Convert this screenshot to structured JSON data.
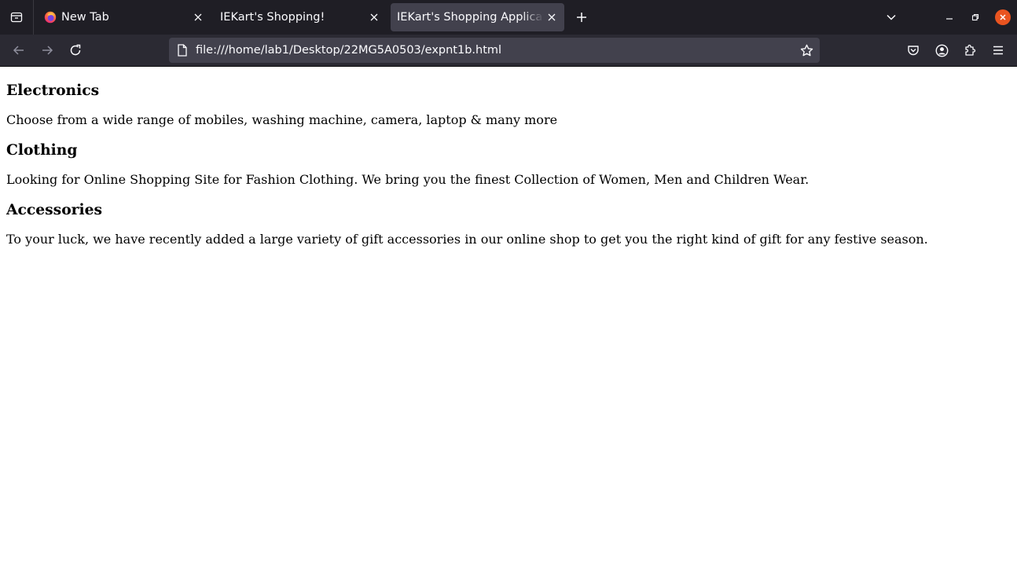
{
  "browser": {
    "tabs": [
      {
        "title": "New Tab",
        "icon": "firefox-icon",
        "active": false
      },
      {
        "title": "IEKart's Shopping!",
        "active": false
      },
      {
        "title": "IEKart's Shopping Application",
        "active": true
      }
    ],
    "url": "file:///home/lab1/Desktop/22MG5A0503/expnt1b.html",
    "accent_color": "#e95420"
  },
  "page": {
    "sections": [
      {
        "heading": "Electronics",
        "text": "Choose from a wide range of mobiles, washing machine, camera, laptop & many more"
      },
      {
        "heading": "Clothing",
        "text": "Looking for Online Shopping Site for Fashion Clothing. We bring you the finest Collection of Women, Men and Children Wear."
      },
      {
        "heading": "Accessories",
        "text": "To your luck, we have recently added a large variety of gift accessories in our online shop to get you the right kind of gift for any festive season."
      }
    ]
  }
}
